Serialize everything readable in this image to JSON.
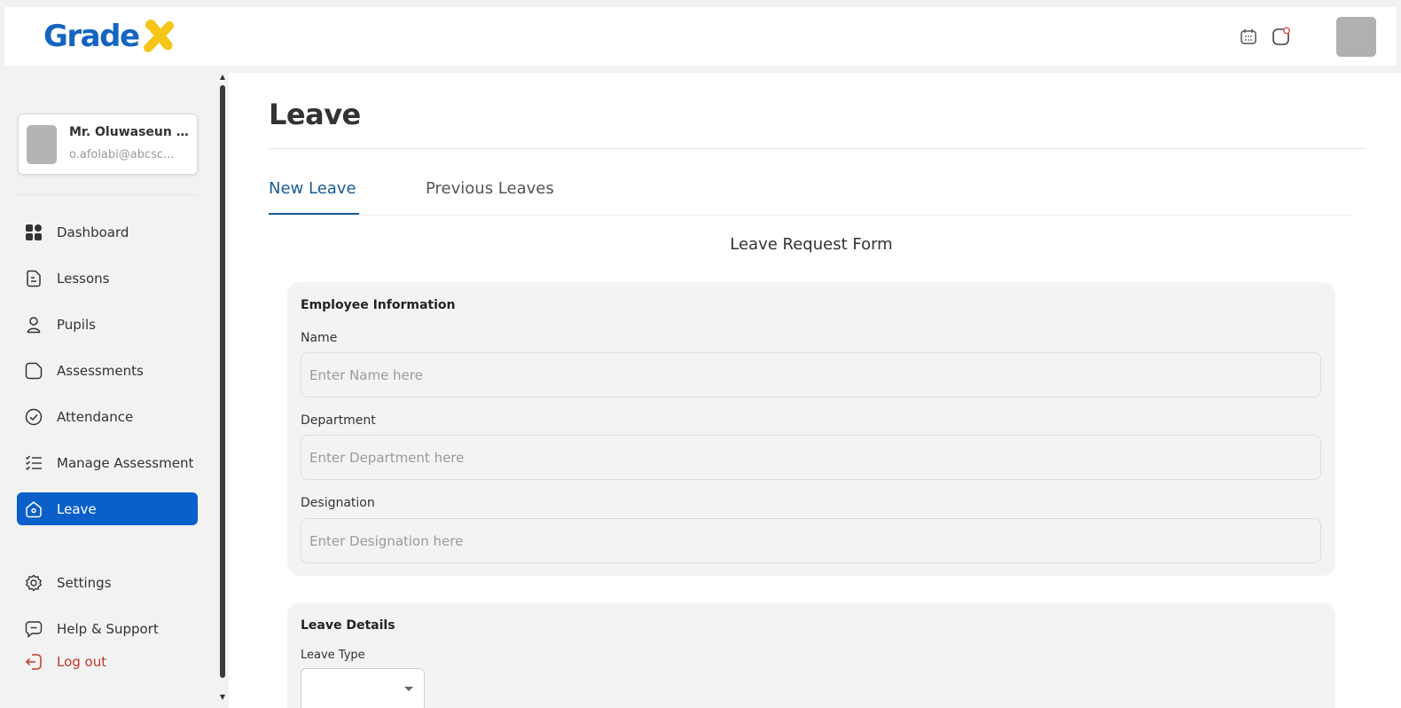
{
  "brand": {
    "logo_text": "Grade",
    "accent_blue": "#1565c0",
    "accent_yellow": "#f5c518",
    "active_nav": "#0a5fc9"
  },
  "header": {
    "icons": [
      "calendar-icon",
      "notification-icon"
    ]
  },
  "profile": {
    "name": "Mr. Oluwaseun ...",
    "email": "o.afolabi@abcsc..."
  },
  "sidebar": {
    "items": [
      {
        "label": "Dashboard",
        "icon": "dashboard-icon"
      },
      {
        "label": "Lessons",
        "icon": "lessons-icon"
      },
      {
        "label": "Pupils",
        "icon": "pupils-icon"
      },
      {
        "label": "Assessments",
        "icon": "assessments-icon"
      },
      {
        "label": "Attendance",
        "icon": "attendance-icon"
      },
      {
        "label": "Manage Assessment",
        "icon": "checklist-icon"
      },
      {
        "label": "Leave",
        "icon": "leave-icon",
        "active": true
      }
    ],
    "footer": [
      {
        "label": "Settings",
        "icon": "settings-icon"
      },
      {
        "label": "Help & Support",
        "icon": "help-icon"
      },
      {
        "label": "Log out",
        "icon": "logout-icon"
      }
    ]
  },
  "main": {
    "title": "Leave",
    "tabs": [
      {
        "label": "New Leave",
        "active": true
      },
      {
        "label": "Previous Leaves",
        "active": false
      }
    ],
    "form_title": "Leave Request Form",
    "employee_section": {
      "title": "Employee Information",
      "fields": [
        {
          "label": "Name",
          "placeholder": "Enter Name here",
          "value": ""
        },
        {
          "label": "Department",
          "placeholder": "Enter Department here",
          "value": ""
        },
        {
          "label": "Designation",
          "placeholder": "Enter Designation here",
          "value": ""
        }
      ]
    },
    "leave_section": {
      "title": "Leave Details",
      "leave_type_label": "Leave Type",
      "leave_type_value": ""
    }
  }
}
